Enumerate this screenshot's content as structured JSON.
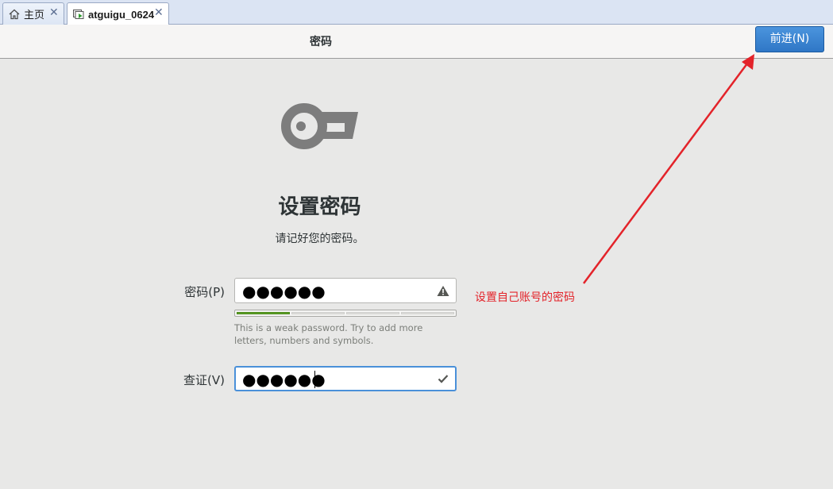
{
  "tabs": [
    {
      "label": "主页",
      "icon": "home-icon"
    },
    {
      "label": "atguigu_0624",
      "icon": "vm-running-icon"
    }
  ],
  "header": {
    "title": "密码",
    "next_label": "前进(N)"
  },
  "main": {
    "icon": "key-icon",
    "title": "设置密码",
    "subtitle": "请记好您的密码。",
    "password": {
      "label": "密码(P)",
      "masked_value": "●●●●●●",
      "status_icon": "warning-icon"
    },
    "strength": {
      "filled_segments": 1,
      "total_segments": 4
    },
    "hint": "This is a weak password. Try to add more letters, numbers and symbols.",
    "confirm": {
      "label": "查证(V)",
      "masked_value": "●●●●●●",
      "status_icon": "check-icon"
    }
  },
  "annotation": {
    "text": "设置自己账号的密码",
    "color": "#e3232a"
  },
  "colors": {
    "accent": "#3584e4",
    "strength_fill": "#5ea027"
  }
}
